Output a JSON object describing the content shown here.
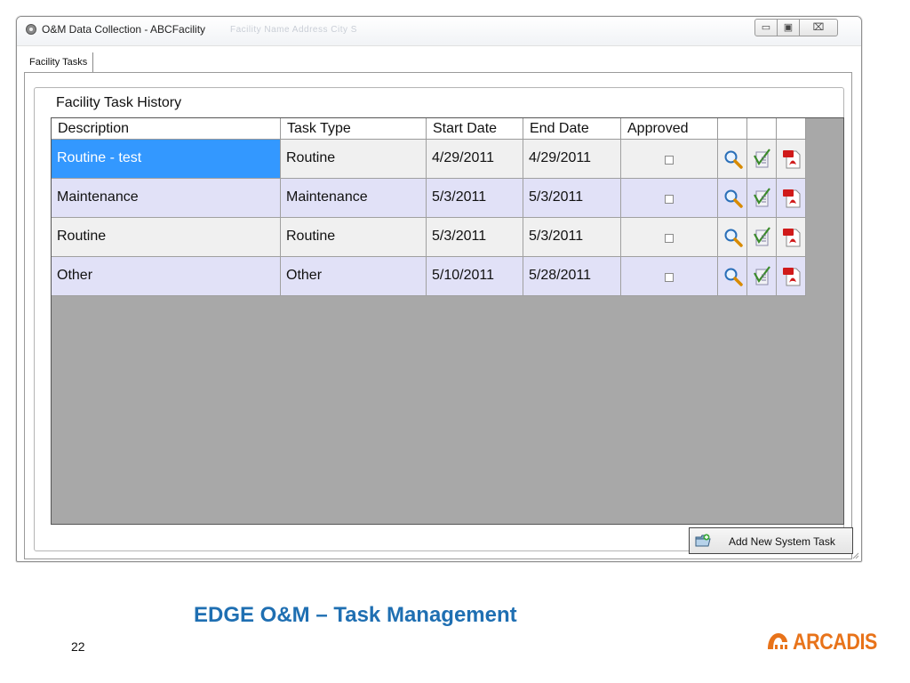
{
  "window": {
    "title": "O&M Data Collection - ABCFacility",
    "ghost_title": "Facility Name        Address                               City                   S",
    "buttons": {
      "minimize": "▭",
      "maximize": "▣",
      "close": "⌧"
    }
  },
  "tabs": [
    {
      "label": "Facility Tasks",
      "active": true
    }
  ],
  "panel": {
    "legend": "Facility Task History"
  },
  "grid": {
    "columns": [
      "Description",
      "Task Type",
      "Start Date",
      "End Date",
      "Approved",
      "",
      "",
      ""
    ],
    "rows": [
      {
        "description": "Routine - test",
        "task_type": "Routine",
        "start_date": "4/29/2011",
        "end_date": "4/29/2011",
        "approved": false,
        "selected": true
      },
      {
        "description": "Maintenance",
        "task_type": "Maintenance",
        "start_date": "5/3/2011",
        "end_date": "5/3/2011",
        "approved": false,
        "selected": false
      },
      {
        "description": "Routine",
        "task_type": "Routine",
        "start_date": "5/3/2011",
        "end_date": "5/3/2011",
        "approved": false,
        "selected": false
      },
      {
        "description": "Other",
        "task_type": "Other",
        "start_date": "5/10/2011",
        "end_date": "5/28/2011",
        "approved": false,
        "selected": false
      }
    ],
    "row_actions": [
      "magnifier-icon",
      "checklist-icon",
      "pdf-icon"
    ]
  },
  "add_button": {
    "label": "Add New System Task",
    "icon": "folder-add-icon"
  },
  "slide": {
    "title": "EDGE O&M – Task Management",
    "page_number": "22",
    "logo_text": "ARCADIS",
    "title_color": "#1f6fb2",
    "logo_color": "#e8731a"
  },
  "colors": {
    "selected": "#3398ff",
    "row_alt": "#e1e1f7",
    "grid_bg": "#a8a8a8"
  }
}
